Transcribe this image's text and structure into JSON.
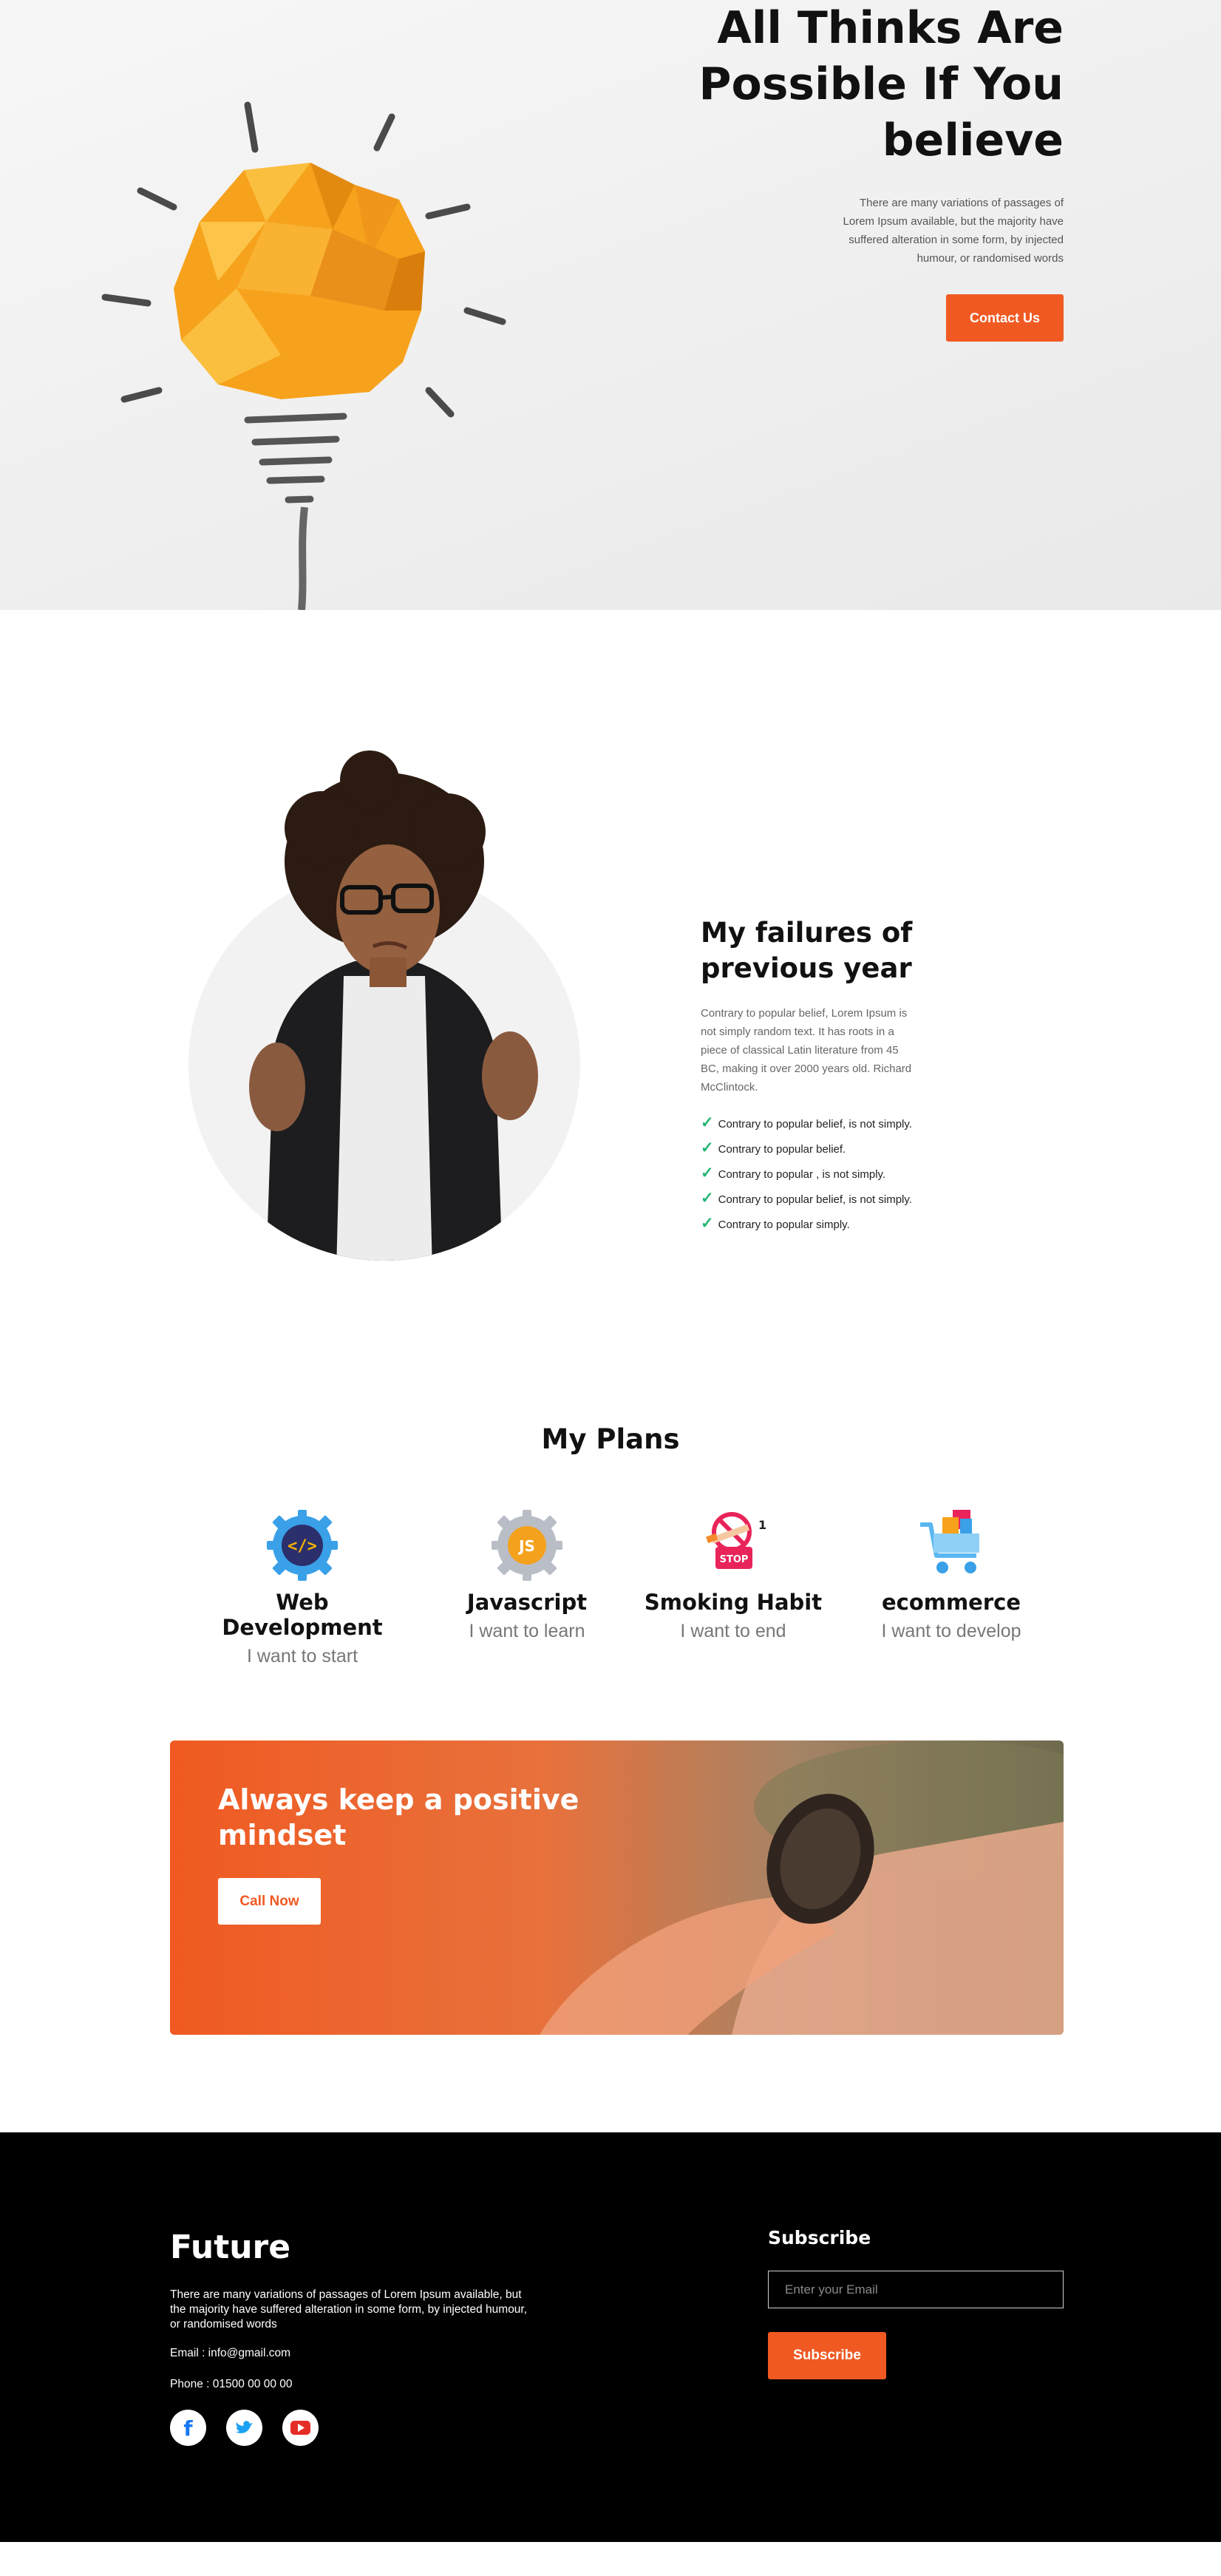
{
  "hero": {
    "title": "All Thinks Are Possible If You believe",
    "description": "There are many variations of passages of Lorem Ipsum available, but the majority have suffered alteration in some form, by injected humour, or randomised words",
    "button_label": "Contact Us"
  },
  "failures": {
    "title": "My failures of previous year",
    "description": "Contrary to popular belief, Lorem Ipsum is not simply random text. It has roots in a piece of classical Latin literature from 45 BC, making it over 2000 years old. Richard McClintock.",
    "items": [
      "Contrary to popular belief, is not simply.",
      "Contrary to popular belief.",
      "Contrary to popular , is not simply.",
      "Contrary to popular belief, is not simply.",
      "Contrary to popular simply."
    ]
  },
  "plans": {
    "title": "My Plans",
    "items": [
      {
        "name": "Web Development",
        "subtitle": "I want to start",
        "icon": "code-gear-icon"
      },
      {
        "name": "Javascript",
        "subtitle": "I want to learn",
        "icon": "js-gear-icon"
      },
      {
        "name": "Smoking Habit",
        "subtitle": "I want to end",
        "icon": "stop-smoking-icon"
      },
      {
        "name": "ecommerce",
        "subtitle": "I want to develop",
        "icon": "shopping-cart-icon"
      }
    ]
  },
  "cta": {
    "title": "Always keep a positive mindset",
    "button_label": "Call Now"
  },
  "footer": {
    "brand": "Future",
    "description": "There are many variations of passages of Lorem Ipsum available, but the majority have suffered alteration in some form, by injected humour, or randomised words",
    "email": "Email : info@gmail.com",
    "phone": "Phone : 01500 00 00 00",
    "social": [
      "facebook-icon",
      "twitter-icon",
      "youtube-icon"
    ],
    "subscribe_title": "Subscribe",
    "email_placeholder": "Enter your Email",
    "subscribe_button": "Subscribe"
  },
  "colors": {
    "accent": "#f05a22",
    "check": "#22b573",
    "footer_bg": "#000000"
  }
}
